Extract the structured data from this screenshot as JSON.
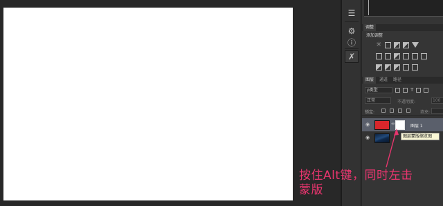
{
  "panels": {
    "adjustments": {
      "tab_label": "调整",
      "add_label": "添加调整"
    },
    "layers": {
      "tabs": [
        {
          "label": "图层",
          "active": true
        },
        {
          "label": "通道",
          "active": false
        },
        {
          "label": "路径",
          "active": false
        }
      ],
      "filter_label": "ρ类型",
      "blend_mode": "正常",
      "opacity_label": "不透明度:",
      "opacity_value": "100",
      "lock_label": "锁定:",
      "fill_label": "填充:",
      "items": [
        {
          "name": "图层 1",
          "selected": true,
          "thumb_color": "#d8262b",
          "has_mask": true
        },
        {
          "name": "",
          "selected": false,
          "thumb": "background-photo"
        }
      ],
      "tooltip": "图层蒙版缩览图"
    }
  },
  "annotation": {
    "line1": "按住Alt键，同时左击",
    "line2": "蒙版",
    "color": "#e8356e"
  },
  "icons": [
    "panel-toggle-icon",
    "properties-icon",
    "info-icon",
    "tools-icon",
    "eye-icon",
    "link-icon",
    "sun-icon"
  ]
}
